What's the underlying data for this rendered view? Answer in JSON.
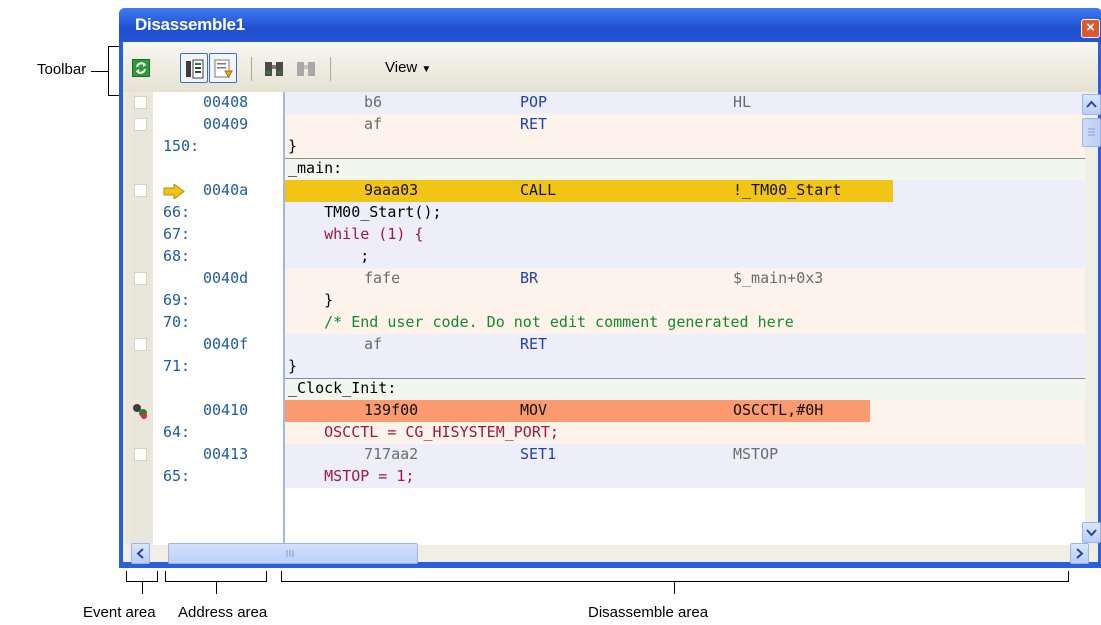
{
  "window": {
    "title": "Disassemble1"
  },
  "toolbar": {
    "view_label": "View"
  },
  "callouts": {
    "toolbar": "Toolbar",
    "event_area": "Event area",
    "address_area": "Address area",
    "disassemble_area": "Disassemble area"
  },
  "rows": [
    {
      "kind": "asm",
      "addr": "00408",
      "opcode": "b6",
      "mnemonic": "POP",
      "operand": "HL"
    },
    {
      "kind": "asm",
      "addr": "00409",
      "opcode": "af",
      "mnemonic": "RET",
      "operand": ""
    },
    {
      "kind": "src",
      "line": "150:",
      "text": "}"
    },
    {
      "kind": "label",
      "text": "_main:"
    },
    {
      "kind": "asm",
      "addr": "0040a",
      "opcode": "9aaa03",
      "mnemonic": "CALL",
      "operand": "!_TM00_Start",
      "current": true
    },
    {
      "kind": "src",
      "line": "66:",
      "text": "    TM00_Start();"
    },
    {
      "kind": "src",
      "line": "67:",
      "text": "    while (1) {"
    },
    {
      "kind": "src",
      "line": "68:",
      "text": "        ;"
    },
    {
      "kind": "asm",
      "addr": "0040d",
      "opcode": "fafe",
      "mnemonic": "BR",
      "operand": "$_main+0x3"
    },
    {
      "kind": "src",
      "line": "69:",
      "text": "    }"
    },
    {
      "kind": "src",
      "line": "70:",
      "text": "    /* End user code. Do not edit comment generated here"
    },
    {
      "kind": "asm",
      "addr": "0040f",
      "opcode": "af",
      "mnemonic": "RET",
      "operand": ""
    },
    {
      "kind": "src",
      "line": "71:",
      "text": "}"
    },
    {
      "kind": "label",
      "text": "_Clock_Init:"
    },
    {
      "kind": "asm",
      "addr": "00410",
      "opcode": "139f00",
      "mnemonic": "MOV",
      "operand": "OSCCTL,#0H",
      "event": true
    },
    {
      "kind": "src",
      "line": "64:",
      "text": "    OSCCTL = CG_HISYSTEM_PORT;"
    },
    {
      "kind": "asm",
      "addr": "00413",
      "opcode": "717aa2",
      "mnemonic": "SET1",
      "operand": "MSTOP"
    },
    {
      "kind": "src",
      "line": "65:",
      "text": "    MSTOP = 1;"
    }
  ],
  "colors": {
    "current_line": "#f2c416",
    "event_line": "#fb9a6e",
    "asm_bg_a": "#eeeefb",
    "asm_bg_b": "#fdf3ea",
    "label_bg": "#f1f6ef",
    "title_bar": "#2b5fd9"
  }
}
